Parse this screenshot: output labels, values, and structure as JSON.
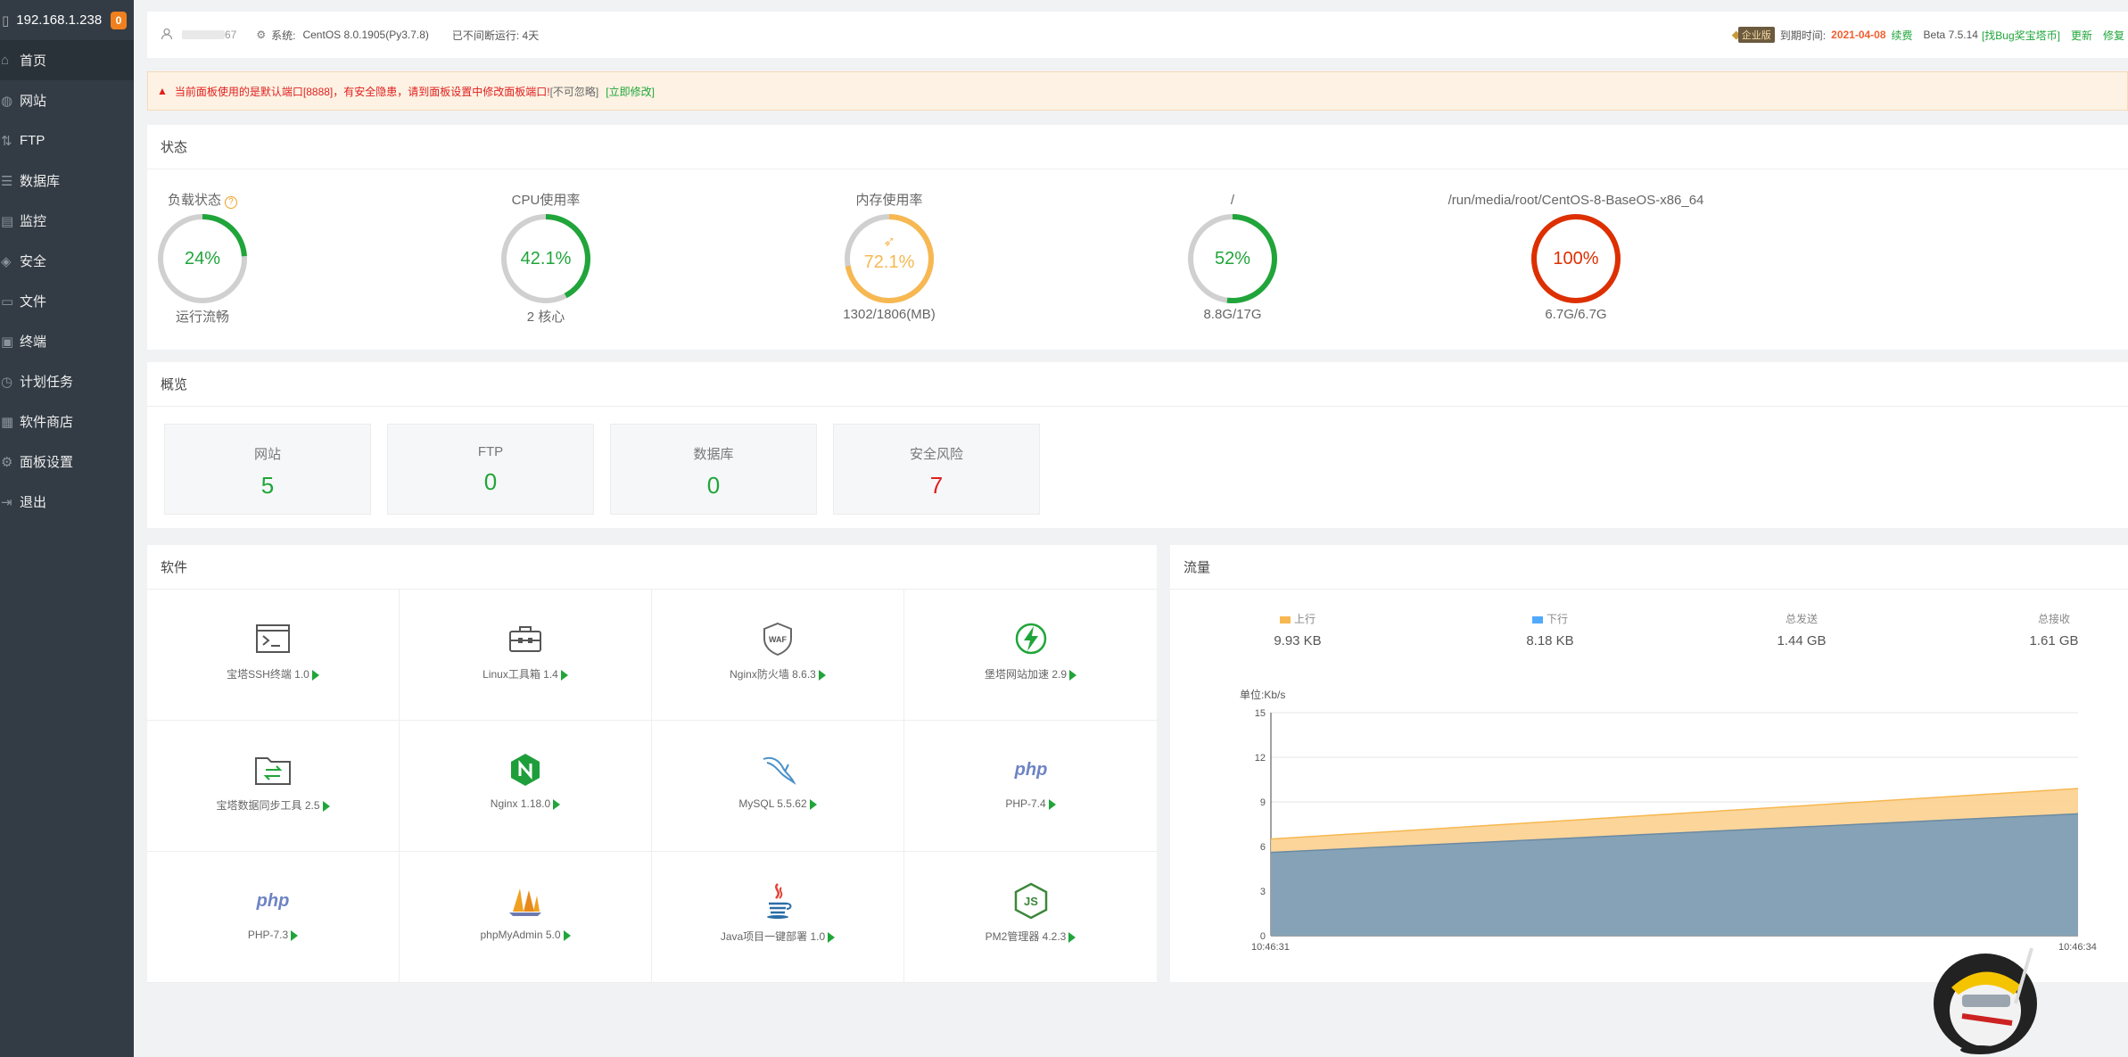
{
  "sidebar": {
    "ip": "192.168.1.238",
    "badge": "0",
    "items": [
      {
        "label": "首页",
        "icon": "home-icon"
      },
      {
        "label": "网站",
        "icon": "globe-icon"
      },
      {
        "label": "FTP",
        "icon": "ftp-icon"
      },
      {
        "label": "数据库",
        "icon": "database-icon"
      },
      {
        "label": "监控",
        "icon": "monitor-icon"
      },
      {
        "label": "安全",
        "icon": "shield-icon"
      },
      {
        "label": "文件",
        "icon": "folder-icon"
      },
      {
        "label": "终端",
        "icon": "terminal-icon"
      },
      {
        "label": "计划任务",
        "icon": "clock-icon"
      },
      {
        "label": "软件商店",
        "icon": "grid-icon"
      },
      {
        "label": "面板设置",
        "icon": "gear-icon"
      },
      {
        "label": "退出",
        "icon": "logout-icon"
      }
    ]
  },
  "topbar": {
    "user": "67",
    "sys_label": "系统:",
    "sys_value": "CentOS 8.0.1905(Py3.7.8)",
    "uptime": "已不间断运行: 4天",
    "edition": "企业版",
    "expire_label": "到期时间:",
    "expire_date": "2021-04-08",
    "renew": "续费",
    "version": "Beta 7.5.14",
    "bug_link": "[找Bug奖宝塔币]",
    "update": "更新",
    "repair": "修复"
  },
  "alert": {
    "text": "当前面板使用的是默认端口[8888]，有安全隐患，请到面板设置中修改面板端口!",
    "ignore": "[不可忽略]",
    "fix": "[立即修改]"
  },
  "status": {
    "title": "状态",
    "gauges": [
      {
        "title": "负载状态",
        "value": "24%",
        "percent": 24,
        "color": "#20a53a",
        "bottom": "运行流畅",
        "help": "?"
      },
      {
        "title": "CPU使用率",
        "value": "42.1%",
        "percent": 42.1,
        "color": "#20a53a",
        "bottom": "2 核心"
      },
      {
        "title": "内存使用率",
        "value": "72.1%",
        "percent": 72.1,
        "color": "#f7b851",
        "bottom": "1302/1806(MB)"
      },
      {
        "title": "/",
        "value": "52%",
        "percent": 52,
        "color": "#20a53a",
        "bottom": "8.8G/17G"
      },
      {
        "title": "/run/media/root/CentOS-8-BaseOS-x86_64",
        "value": "100%",
        "percent": 100,
        "color": "#dd2f00",
        "bottom": "6.7G/6.7G"
      }
    ]
  },
  "overview": {
    "title": "概览",
    "items": [
      {
        "label": "网站",
        "value": "5",
        "color": "#20a53a"
      },
      {
        "label": "FTP",
        "value": "0",
        "color": "#20a53a"
      },
      {
        "label": "数据库",
        "value": "0",
        "color": "#20a53a"
      },
      {
        "label": "安全风险",
        "value": "7",
        "color": "#e02020"
      }
    ]
  },
  "software": {
    "title": "软件",
    "items": [
      {
        "name": "宝塔SSH终端 1.0",
        "icon": "ssh-terminal-icon"
      },
      {
        "name": "Linux工具箱 1.4",
        "icon": "toolbox-icon"
      },
      {
        "name": "Nginx防火墙 8.6.3",
        "icon": "waf-shield-icon"
      },
      {
        "name": "堡塔网站加速 2.9",
        "icon": "lightning-icon"
      },
      {
        "name": "宝塔数据同步工具 2.5",
        "icon": "folder-sync-icon"
      },
      {
        "name": "Nginx 1.18.0",
        "icon": "nginx-icon"
      },
      {
        "name": "MySQL 5.5.62",
        "icon": "mysql-dolphin-icon"
      },
      {
        "name": "PHP-7.4",
        "icon": "php-icon"
      },
      {
        "name": "PHP-7.3",
        "icon": "php-icon"
      },
      {
        "name": "phpMyAdmin 5.0",
        "icon": "phpmyadmin-sail-icon"
      },
      {
        "name": "Java项目一键部署 1.0",
        "icon": "java-icon"
      },
      {
        "name": "PM2管理器 4.2.3",
        "icon": "nodejs-icon"
      }
    ]
  },
  "traffic": {
    "title": "流量",
    "stats": [
      {
        "label": "上行",
        "value": "9.93 KB",
        "color": "#f7b851"
      },
      {
        "label": "下行",
        "value": "8.18 KB",
        "color": "#52a9ff"
      },
      {
        "label": "总发送",
        "value": "1.44 GB"
      },
      {
        "label": "总接收",
        "value": "1.61 GB"
      }
    ]
  },
  "chart_data": {
    "type": "area",
    "title": "",
    "ylabel": "单位:Kb/s",
    "xlabel": "",
    "x": [
      "10:46:31",
      "10:46:34"
    ],
    "ylim": [
      0,
      15
    ],
    "yticks": [
      0,
      3,
      6,
      9,
      12,
      15
    ],
    "series": [
      {
        "name": "上行",
        "values": [
          6.5,
          9.9
        ],
        "color": "#f7b851"
      },
      {
        "name": "下行",
        "values": [
          5.6,
          8.2
        ],
        "color": "#52a9ff"
      }
    ]
  }
}
